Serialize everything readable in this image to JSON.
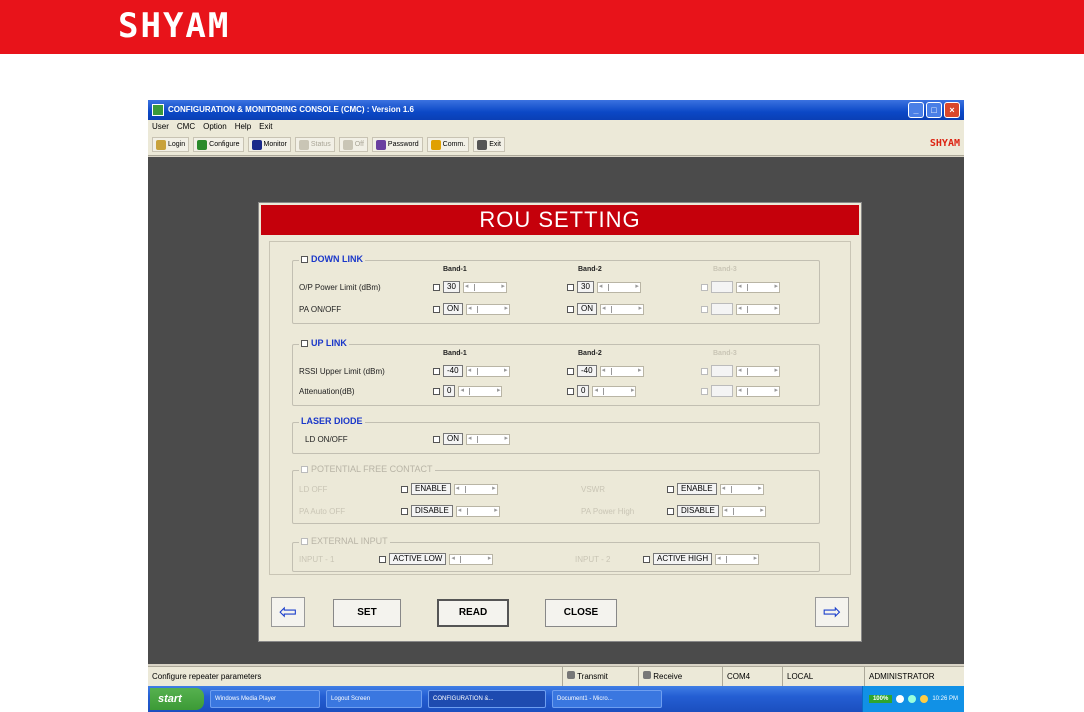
{
  "brand": {
    "logo_text": "SHYAM",
    "color": "#e8131a"
  },
  "window": {
    "title": "CONFIGURATION & MONITORING CONSOLE (CMC) : Version 1.6",
    "buttons": [
      "_",
      "□",
      "×"
    ]
  },
  "menu": [
    "User",
    "CMC",
    "Option",
    "Help",
    "Exit"
  ],
  "toolbar": {
    "items": [
      {
        "label": "Login",
        "icon": "login-icon",
        "dim": false
      },
      {
        "label": "Configure",
        "icon": "configure-icon",
        "dim": false
      },
      {
        "label": "Monitor",
        "icon": "monitor-icon",
        "dim": false
      },
      {
        "label": "Status",
        "icon": "status-icon",
        "dim": true
      },
      {
        "label": "Off",
        "icon": "off-icon",
        "dim": true
      },
      {
        "label": "Password",
        "icon": "password-icon",
        "dim": false
      },
      {
        "label": "Comm.",
        "icon": "comm-icon",
        "dim": false
      },
      {
        "label": "Exit",
        "icon": "exit-icon",
        "dim": false
      }
    ],
    "brand": "SHYAM"
  },
  "rou": {
    "title": "ROU SETTING",
    "downlink": {
      "label": "DOWN LINK",
      "bands": [
        "Band-1",
        "Band-2",
        "Band-3"
      ],
      "rows": [
        {
          "label": "O/P Power Limit (dBm)",
          "values": [
            "30",
            "30",
            ""
          ]
        },
        {
          "label": "PA ON/OFF",
          "values": [
            "ON",
            "ON",
            ""
          ]
        }
      ]
    },
    "uplink": {
      "label": "UP LINK",
      "bands": [
        "Band-1",
        "Band-2",
        "Band-3"
      ],
      "rows": [
        {
          "label": "RSSI Upper Limit (dBm)",
          "values": [
            "-40",
            "-40",
            ""
          ]
        },
        {
          "label": "Attenuation(dB)",
          "values": [
            "0",
            "0",
            ""
          ]
        }
      ]
    },
    "laser": {
      "label": "LASER DIODE",
      "row_label": "LD ON/OFF",
      "value": "ON"
    },
    "pfc": {
      "label": "POTENTIAL FREE CONTACT",
      "left": [
        {
          "label": "LD OFF",
          "value": "ENABLE"
        },
        {
          "label": "PA Auto OFF",
          "value": "DISABLE"
        }
      ],
      "right": [
        {
          "label": "VSWR",
          "value": "ENABLE"
        },
        {
          "label": "PA Power High",
          "value": "DISABLE"
        }
      ]
    },
    "ext": {
      "label": "EXTERNAL INPUT",
      "inputs": [
        {
          "label": "INPUT - 1",
          "value": "ACTIVE LOW"
        },
        {
          "label": "INPUT - 2",
          "value": "ACTIVE HIGH"
        }
      ]
    },
    "buttons": {
      "set": "SET",
      "read": "READ",
      "close": "CLOSE",
      "prev": "⇦",
      "next": "⇨"
    }
  },
  "status": {
    "message": "Configure repeater parameters",
    "transmit": "Transmit",
    "receive": "Receive",
    "port": "COM4",
    "mode": "LOCAL",
    "user": "ADMINISTRATOR"
  },
  "taskbar": {
    "start": "start",
    "tasks": [
      "Windows Media Player",
      "Logout Screen",
      "CONFIGURATION &...",
      "Document1 - Micro..."
    ],
    "battery": "100%",
    "clock": "10:26 PM"
  }
}
